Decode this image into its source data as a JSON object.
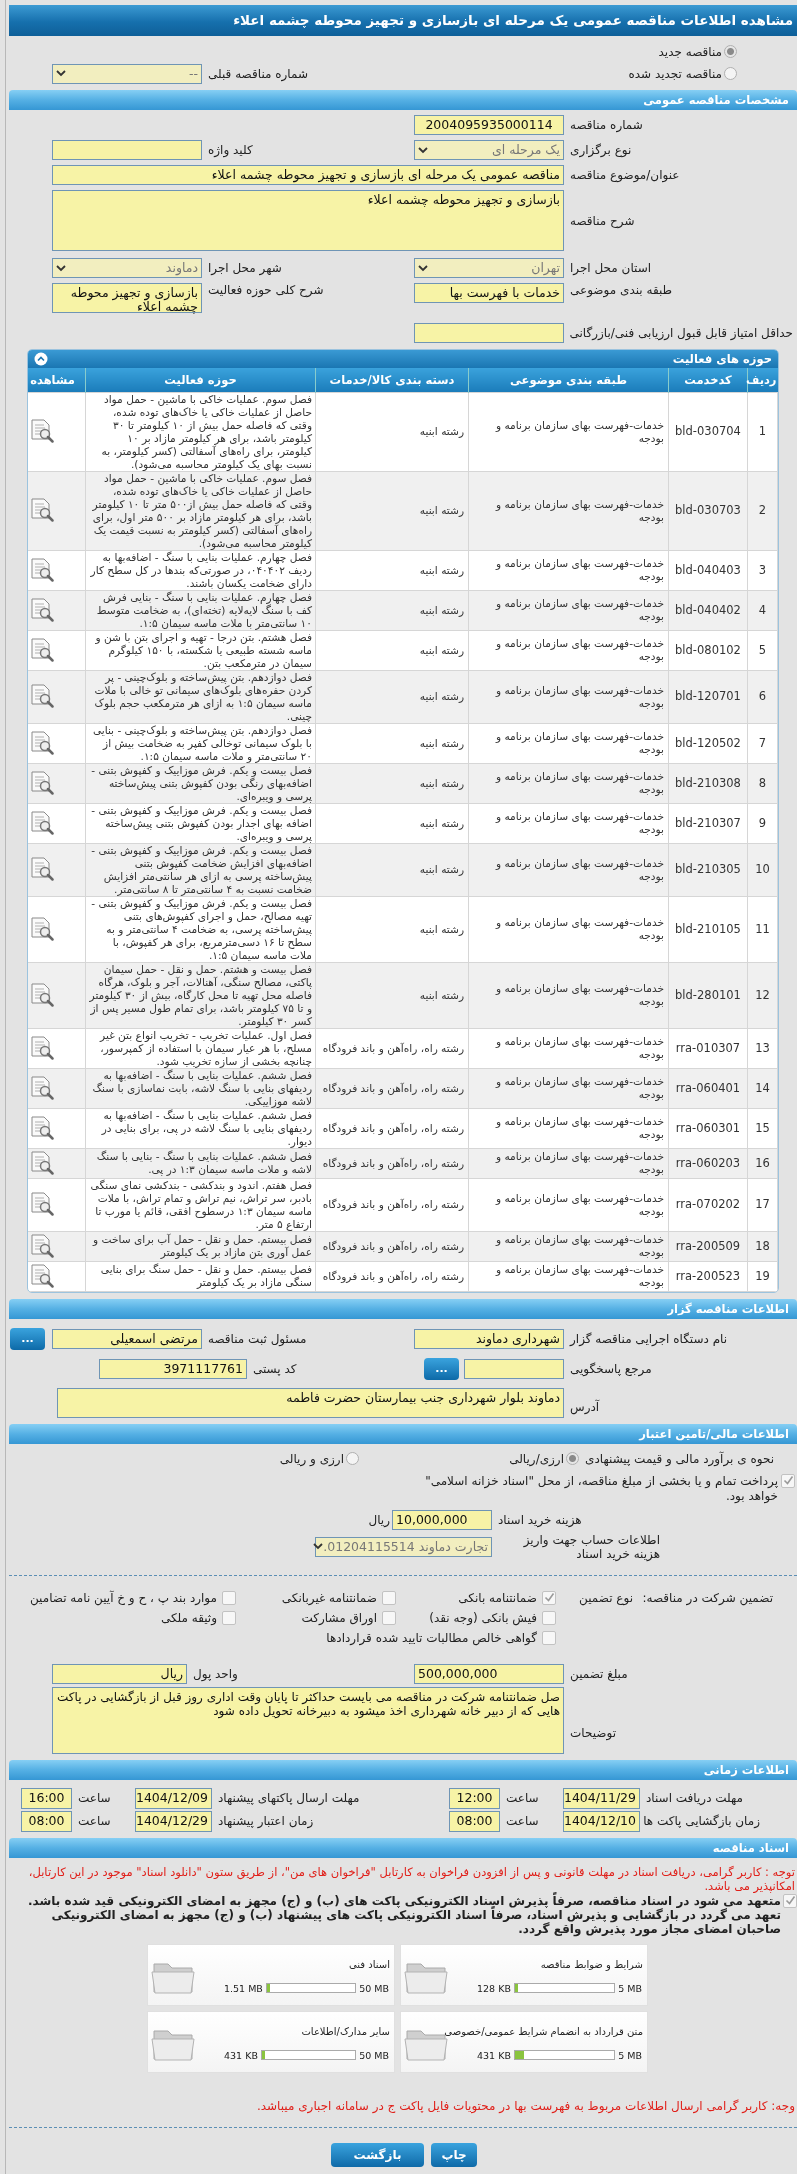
{
  "page_title": "مشاهده اطلاعات مناقصه عمومی یک مرحله ای بازسازی و تجهیز محوطه چشمه اعلاء",
  "tender_status": [
    {
      "label": "مناقصه جدید",
      "selected": true
    },
    {
      "label": "مناقصه تجدید شده",
      "selected": false
    }
  ],
  "previous_tender": {
    "label": "شماره مناقصه قبلی",
    "value": "--"
  },
  "general": {
    "title": "مشخصات مناقصه عمومی",
    "fields": [
      {
        "label": "شماره مناقصه",
        "value": "2004095935000114",
        "kind": "text"
      },
      {
        "label": "نوع برگزاری",
        "value": "یک مرحله ای",
        "kind": "select"
      },
      {
        "label": "کلید واژه",
        "kind": "text"
      },
      {
        "label": "عنوان/موضوع مناقصه",
        "value": "مناقصه عمومی یک مرحله ای بازسازی و تجهیز محوطه چشمه اعلاء",
        "kind": "text"
      },
      {
        "label": "شرح مناقصه",
        "value": "بازسازی و تجهیز محوطه چشمه اعلاء",
        "kind": "textarea"
      },
      {
        "label": "استان محل اجرا",
        "value": "تهران",
        "kind": "select"
      },
      {
        "label": "شهر محل اجرا",
        "value": "دماوند",
        "kind": "select"
      },
      {
        "label": "طبقه بندی موضوعی",
        "value": "خدمات با فهرست بها",
        "kind": "text"
      },
      {
        "label": "شرح کلی حوزه فعالیت",
        "value": "بازسازی و تجهیز محوطه چشمه اعلاء",
        "kind": "textarea"
      },
      {
        "label": "حداقل امتیاز قابل قبول ارزیابی فنی/بازرگانی",
        "kind": "text"
      }
    ]
  },
  "activities": {
    "title": "حوزه های فعالیت",
    "columns": [
      "ردیف",
      "کدخدمت",
      "طبقه بندی موضوعی",
      "دسته بندی کالا/خدمات",
      "حوزه فعالیت",
      "مشاهده"
    ],
    "rows": [
      {
        "index": "1",
        "code": "bld-030704",
        "category": "خدمات-فهرست بهای سازمان برنامه و بودجه",
        "group": "رشته ابنیه",
        "description": "فصل سوم. عملیات خاکی با ماشین - حمل مواد حاصل از عملیات خاکی یا خاک‌های توده شده، وقتی که فاصله حمل بیش از ۱۰ کیلومتر تا ۳۰ کیلومتر باشد، برای هر کیلومتر مازاد بر ۱۰ کیلومتر، برای راه‌های آسفالتی (کسر کیلومتر، به نسبت بهای یک کیلومتر محاسبه می‌شود)."
      },
      {
        "index": "2",
        "code": "bld-030703",
        "category": "خدمات-فهرست بهای سازمان برنامه و بودجه",
        "group": "رشته ابنیه",
        "description": "فصل سوم. عملیات خاکی با ماشین - حمل مواد حاصل از عملیات خاکی یا خاک‌های توده شده، وقتی  که فاصله حمل بیش از۵۰۰ متر تا ۱۰ کیلومتر باشد، برای هر کیلومتر مازاد بر ۵۰۰  متر اول، برای راه‌های آسفالتی (کسر کیلومتر به نسبت قیمت یک کیلومتر محاسبه می‌شود)."
      },
      {
        "index": "3",
        "code": "bld-040403",
        "category": "خدمات-فهرست بهای سازمان برنامه و بودجه",
        "group": "رشته ابنیه",
        "description": "فصل چهارم. عملیات بنایی با سنگ - اضافه‌بها به ردیف ۰۴۰۴۰۲، در صورتی‌که بندها در کل سطح کار دارای ضخامت یکسان باشند."
      },
      {
        "index": "4",
        "code": "bld-040402",
        "category": "خدمات-فهرست بهای سازمان برنامه و بودجه",
        "group": "رشته ابنیه",
        "description": "فصل چهارم. عملیات بنایی با سنگ - بنایی فرش کف با سنگ لایه‌لایه (تخته‌ای)، به ضخامت متوسط ۱۰ سانتی‌متر با ملات ماسه سیمان ۱:۵."
      },
      {
        "index": "5",
        "code": "bld-080102",
        "category": "خدمات-فهرست بهای سازمان برنامه و بودجه",
        "group": "رشته ابنیه",
        "description": "فصل هشتم. بتن درجا - تهیه و اجرای بتن با شن و ماسه شسته طبیعی یا شکسته، با ۱۵۰ کیلوگرم سیمان در مترمکعب بتن."
      },
      {
        "index": "6",
        "code": "bld-120701",
        "category": "خدمات-فهرست بهای سازمان برنامه و بودجه",
        "group": "رشته ابنیه",
        "description": "فصل دوازدهم. بتن پیش‌ساخته و بلوک‌چینی - پر کردن حفره‌های بلوک‌های سیمانی تو خالی با ملات ماسه سیمان ۱:۵ به ازای هر مترمکعب حجم بلوک چینی."
      },
      {
        "index": "7",
        "code": "bld-120502",
        "category": "خدمات-فهرست بهای سازمان برنامه و بودجه",
        "group": "رشته ابنیه",
        "description": "فصل دوازدهم. بتن پیش‌ساخته و بلوک‌چینی - بنایی با بلوک سیمانی توخالی کفپر به ضخامت بیش از ۲۰ سانتی‌متر و ملات ماسه سیمان ۱:۵."
      },
      {
        "index": "8",
        "code": "bld-210308",
        "category": "خدمات-فهرست بهای سازمان برنامه و بودجه",
        "group": "رشته ابنیه",
        "description": "فصل بیست و یکم. فرش موزاییک و کفپوش بتنی - اضافه‌بهای رنگی بودن کفپوش بتنی پیش‌ساخته پرسی و ویبره‌ای."
      },
      {
        "index": "9",
        "code": "bld-210307",
        "category": "خدمات-فهرست بهای سازمان برنامه و بودجه",
        "group": "رشته ابنیه",
        "description": "فصل بیست و یکم. فرش موزاییک و کفپوش بتنی - اضافه بهای اجدار بودن کفپوش بتنی پیش‌ساخته پرسی و ویبره‌ای."
      },
      {
        "index": "10",
        "code": "bld-210305",
        "category": "خدمات-فهرست بهای سازمان برنامه و بودجه",
        "group": "رشته ابنیه",
        "description": "فصل بیست و یکم. فرش موزاییک و کفپوش بتنی - اضافه‌بهای افزایش ضخامت کفپوش بتنی پیش‌ساخته پرسی به ازای هر سانتی‌متر افزایش ضخامت نسبت به ۴ سانتی‌متر تا ۸ سانتی‌متر."
      },
      {
        "index": "11",
        "code": "bld-210105",
        "category": "خدمات-فهرست بهای سازمان برنامه و بودجه",
        "group": "رشته ابنیه",
        "description": "فصل بیست و یکم. فرش موزاییک و کفپوش بتنی - تهیه مصالح، حمل و اجرای کفپوش‌های بتنی پیش‌ساخته پرسی، به ضخامت ۴ سانتی‌متر و به سطح تا ۱۶ دسی‌مترمربع، برای هر کفپوش، با ملات ماسه سیمان ۱:۵."
      },
      {
        "index": "12",
        "code": "bld-280101",
        "category": "خدمات-فهرست بهای سازمان برنامه و بودجه",
        "group": "رشته ابنیه",
        "description": "فصل بیست و هشتم. حمل و نقل - حمل سیمان پاکتی، مصالح سنگی، آهنالات، آجر و بلوک، هرگاه فاصله محل تهیه تا محل کارگاه، بیش از ۳۰ کیلومتر و تا ۷۵ کیلومتر باشد، برای تمام طول مسیر پس از کسر ۳۰ کیلومتر."
      },
      {
        "index": "13",
        "code": "rra-010307",
        "category": "خدمات-فهرست بهای سازمان برنامه و بودجه",
        "group": "رشته راه، راه‌آهن و باند فرودگاه",
        "description": "فصل اول. عملیات تخریب - تخریب انواع بتن غیر مسلح، با هر عیار سیمان با استفاده از کمپرسور، چنانچه بخشی از سازه تخریب شود."
      },
      {
        "index": "14",
        "code": "rra-060401",
        "category": "خدمات-فهرست بهای سازمان برنامه و بودجه",
        "group": "رشته راه، راه‌آهن و باند فرودگاه",
        "description": "فصل ششم. عملیات بنایی با سنگ - اضافه‌بها به ردیفهای بنایی با سنگ لاشه، بابت نماسازی با سنگ لاشه موزاییکی."
      },
      {
        "index": "15",
        "code": "rra-060301",
        "category": "خدمات-فهرست بهای سازمان برنامه و بودجه",
        "group": "رشته راه، راه‌آهن و باند فرودگاه",
        "description": "فصل ششم. عملیات بنایی با سنگ - اضافه‌بها به ردیفهای بنایی با سنگ لاشه در پی، برای بنایی در دیوار."
      },
      {
        "index": "16",
        "code": "rra-060203",
        "category": "خدمات-فهرست بهای سازمان برنامه و بودجه",
        "group": "رشته راه، راه‌آهن و باند فرودگاه",
        "description": "فصل ششم. عملیات بنایی با سنگ - بنایی با سنگ لاشه و ملات ماسه سیمان ۱:۳ در پی."
      },
      {
        "index": "17",
        "code": "rra-070202",
        "category": "خدمات-فهرست بهای سازمان برنامه و بودجه",
        "group": "رشته راه، راه‌آهن و باند فرودگاه",
        "description": "فصل هفتم. اندود و بندکشی - بندکشی نمای سنگی بادبر، سر تراش، نیم تراش و تمام تراش، با ملات ماسه سیمان ۱:۳ درسطوح افقی، قائم یا مورب تا ارتفاع ۵ متر."
      },
      {
        "index": "18",
        "code": "rra-200509",
        "category": "خدمات-فهرست بهای سازمان برنامه و بودجه",
        "group": "رشته راه، راه‌آهن و باند فرودگاه",
        "description": "فصل بیستم. حمل و نقل - حمل آب برای ساخت و عمل آوری بتن مازاد بر یک کیلومتر"
      },
      {
        "index": "19",
        "code": "rra-200523",
        "category": "خدمات-فهرست بهای سازمان برنامه و بودجه",
        "group": "رشته راه، راه‌آهن و باند فرودگاه",
        "description": "فصل بیستم. حمل و نقل - حمل سنگ برای بنایی سنگی مازاد بر یک کیلومتر"
      }
    ]
  },
  "owner": {
    "title": "اطلاعات مناقصه گزار",
    "fields": [
      {
        "label": "نام دستگاه اجرایی مناقصه گزار",
        "value": "شهرداری دماوند"
      },
      {
        "label": "مسئول ثبت مناقصه",
        "value": "مرتضی اسمعیلی",
        "button": "..."
      },
      {
        "label": "مرجع پاسخگویی",
        "button": "..."
      },
      {
        "label": "کد پستی",
        "value": "3971117761"
      },
      {
        "label": "آدرس",
        "value": "دماوند بلوار شهرداری  جنب بیمارستان حضرت فاطمه"
      }
    ]
  },
  "finance": {
    "title": "اطلاعات مالی/تامین اعتبار",
    "estimate_label": "نحوه ی برآورد مالی و قیمت پیشنهادی",
    "estimate_options": [
      {
        "label": "ارزی/ریالی",
        "selected": true
      },
      {
        "label": "ارزی و ریالی",
        "selected": false
      }
    ],
    "treasury": {
      "text": "پرداخت تمام و یا بخشی از مبلغ مناقصه، از محل \"اسناد خزانه اسلامی\" خواهد بود.",
      "checked": true
    },
    "document_fee": {
      "label": "هزینه خرید اسناد",
      "value": "10,000,000",
      "unit": "ریال"
    },
    "account": {
      "label": "اطلاعات حساب جهت واریز هزینه خرید اسناد",
      "value": "تجارت دماوند 01204115514."
    },
    "guarantee_label": "تضمین شرکت در مناقصه:",
    "guarantee_type_label": "نوع تضمین",
    "guarantee_types": [
      {
        "label": "ضمانتنامه بانکی",
        "checked": true
      },
      {
        "label": "ضمانتنامه غیربانکی",
        "checked": false
      },
      {
        "label": "موارد بند پ ، ح و خ آیین نامه تضامین",
        "checked": false
      },
      {
        "label": "فیش بانکی (وجه نقد)",
        "checked": false
      },
      {
        "label": "اوراق مشارکت",
        "checked": false
      },
      {
        "label": "وثیقه ملکی",
        "checked": false
      },
      {
        "label": "گواهی خالص مطالبات تایید شده قراردادها",
        "checked": false
      }
    ],
    "guarantee_amount": {
      "label": "مبلغ تضمین",
      "value": "500,000,000"
    },
    "currency": {
      "label": "واحد پول",
      "value": "ریال"
    },
    "notes": {
      "label": "توضیحات",
      "value": "صل ضمانتنامه شرکت در مناقصه می بایست حداکثر تا پایان وقت اداری روز قبل از بازگشایی در پاکت هایی که از دبیر خانه شهرداری اخذ میشود به دبیرخانه تحویل داده شود"
    }
  },
  "timing": {
    "title": "اطلاعات زمانی",
    "items": [
      {
        "label": "مهلت دریافت اسناد",
        "date": "1404/11/29",
        "time_label": "ساعت",
        "time": "12:00"
      },
      {
        "label": "مهلت ارسال پاکتهای پیشنهاد",
        "date": "1404/12/09",
        "time_label": "ساعت",
        "time": "16:00"
      },
      {
        "label": "زمان بازگشایی پاکت ها",
        "date": "1404/12/10",
        "time_label": "ساعت",
        "time": "08:00"
      },
      {
        "label": "زمان اعتبار پیشنهاد",
        "date": "1404/12/29",
        "time_label": "ساعت",
        "time": "08:00"
      }
    ]
  },
  "documents": {
    "title": "اسناد مناقصه",
    "notice": "توجه : کاربر گرامی، دریافت اسناد در مهلت قانونی و پس از افزودن فراخوان به کارتابل \"فراخوان های من\"، از طریق ستون \"دانلود اسناد\" موجود در این کارتابل، امکانپذیر می باشد.",
    "commitment": {
      "text": "متعهد می شود در اسناد مناقصه، صرفاً پذیرش اسناد الکترونیکی پاکت های (ب) و (ج) مجهز به امضای الکترونیکی قید شده باشد. تعهد می گردد در بازگشایی و پذیرش اسناد، صرفاً اسناد الکترونیکی پاکت های پیشنهاد (ب) و (ج) مجهز به امضای الکترونیکی صاحبان امضای مجاز مورد پذیرش واقع گردد.",
      "checked": true
    },
    "files": [
      {
        "name": "شرایط و ضوابط مناقصه",
        "size": "128 KB",
        "max": "5 MB",
        "level": 0.03
      },
      {
        "name": "اسناد فنی",
        "size": "1.51 MB",
        "max": "50 MB",
        "level": 0.03
      },
      {
        "name": "متن قرارداد به انضمام شرایط عمومی/خصوصی",
        "size": "431 KB",
        "max": "5 MB",
        "level": 0.09
      },
      {
        "name": "سایر مدارک/اطلاعات",
        "size": "431 KB",
        "max": "50 MB",
        "level": 0.01
      }
    ],
    "footer_note": "وجه: کاربر گرامی ارسال اطلاعات مربوط به فهرست بها در محتویات فایل پاکت ج در سامانه اجباری میباشد."
  },
  "buttons": [
    {
      "label": "چاپ"
    },
    {
      "label": "بازگشت"
    }
  ]
}
